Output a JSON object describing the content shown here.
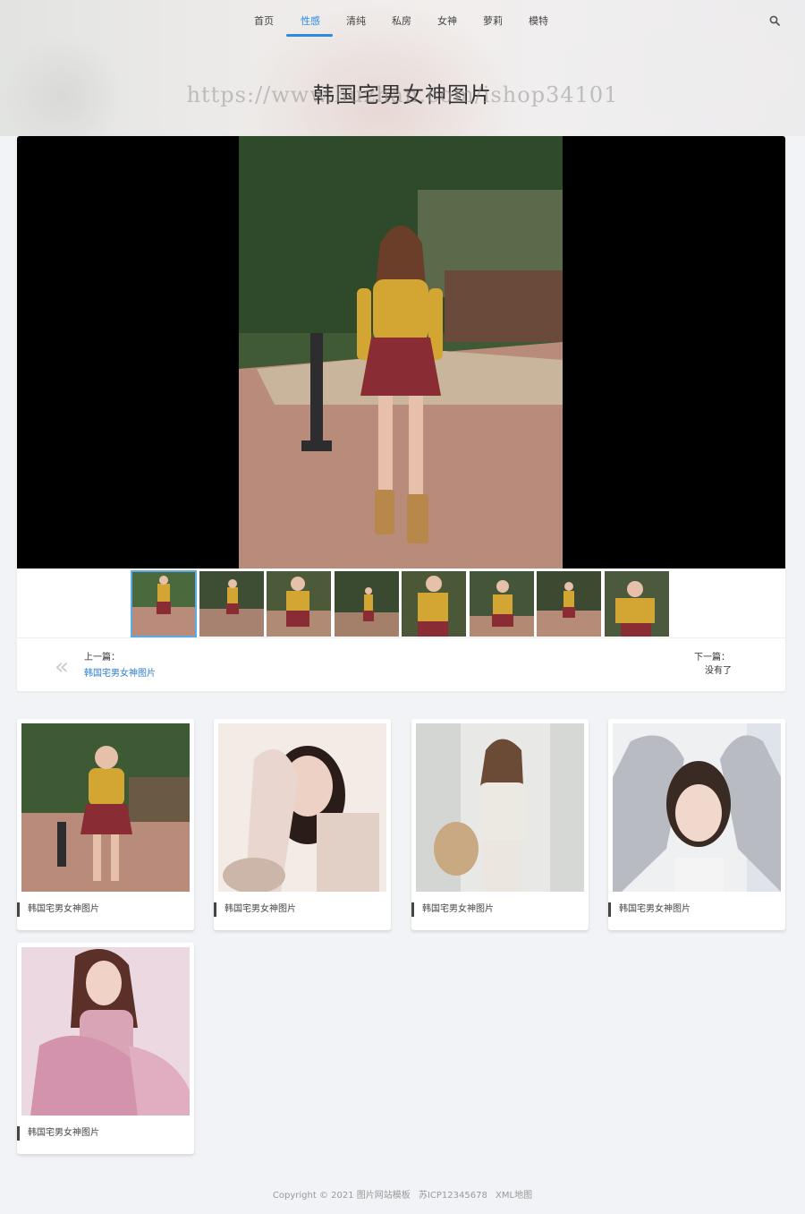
{
  "nav": {
    "items": [
      "首页",
      "性感",
      "清纯",
      "私房",
      "女神",
      "萝莉",
      "模特"
    ],
    "active_index": 1,
    "search_icon": "search-icon"
  },
  "header": {
    "title": "韩国宅男女神图片",
    "watermark": "https://www.huzhan.com/ishop34101"
  },
  "viewer": {
    "thumb_count": 8,
    "active_thumb": 1,
    "prev_label": "上一篇：",
    "prev_link": "韩国宅男女神图片",
    "prev_icon": "double-chevron-left-icon",
    "next_label": "下一篇：",
    "next_value": "没有了"
  },
  "related": [
    {
      "caption": "韩国宅男女神图片"
    },
    {
      "caption": "韩国宅男女神图片"
    },
    {
      "caption": "韩国宅男女神图片"
    },
    {
      "caption": "韩国宅男女神图片"
    },
    {
      "caption": "韩国宅男女神图片"
    }
  ],
  "footer": {
    "copyright": "Copyright © 2021 图片网站模板",
    "icp": "苏ICP12345678",
    "sitemap": "XML地图"
  },
  "colors": {
    "accent": "#2c8ae0",
    "page_bg": "#f2f3f7"
  }
}
